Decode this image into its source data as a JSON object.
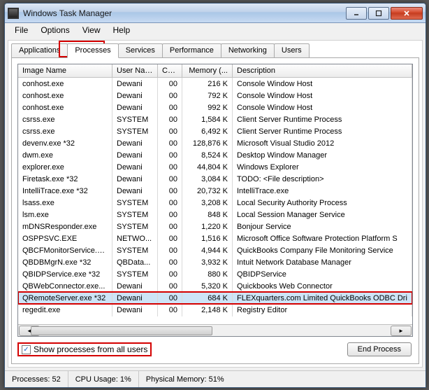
{
  "window": {
    "title": "Windows Task Manager"
  },
  "menu": {
    "file": "File",
    "options": "Options",
    "view": "View",
    "help": "Help"
  },
  "win_btns": {
    "min": "_",
    "max": "□",
    "close": "×"
  },
  "tabs": {
    "items": [
      {
        "label": "Applications"
      },
      {
        "label": "Processes"
      },
      {
        "label": "Services"
      },
      {
        "label": "Performance"
      },
      {
        "label": "Networking"
      },
      {
        "label": "Users"
      }
    ]
  },
  "columns": {
    "name": "Image Name",
    "user": "User Name",
    "cpu": "CPU",
    "mem": "Memory (...",
    "desc": "Description"
  },
  "rows": [
    {
      "name": "conhost.exe",
      "user": "Dewani",
      "cpu": "00",
      "mem": "216 K",
      "desc": "Console Window Host"
    },
    {
      "name": "conhost.exe",
      "user": "Dewani",
      "cpu": "00",
      "mem": "792 K",
      "desc": "Console Window Host"
    },
    {
      "name": "conhost.exe",
      "user": "Dewani",
      "cpu": "00",
      "mem": "992 K",
      "desc": "Console Window Host"
    },
    {
      "name": "csrss.exe",
      "user": "SYSTEM",
      "cpu": "00",
      "mem": "1,584 K",
      "desc": "Client Server Runtime Process"
    },
    {
      "name": "csrss.exe",
      "user": "SYSTEM",
      "cpu": "00",
      "mem": "6,492 K",
      "desc": "Client Server Runtime Process"
    },
    {
      "name": "devenv.exe *32",
      "user": "Dewani",
      "cpu": "00",
      "mem": "128,876 K",
      "desc": "Microsoft Visual Studio 2012"
    },
    {
      "name": "dwm.exe",
      "user": "Dewani",
      "cpu": "00",
      "mem": "8,524 K",
      "desc": "Desktop Window Manager"
    },
    {
      "name": "explorer.exe",
      "user": "Dewani",
      "cpu": "00",
      "mem": "44,804 K",
      "desc": "Windows Explorer"
    },
    {
      "name": "Firetask.exe *32",
      "user": "Dewani",
      "cpu": "00",
      "mem": "3,084 K",
      "desc": "TODO: <File description>"
    },
    {
      "name": "IntelliTrace.exe *32",
      "user": "Dewani",
      "cpu": "00",
      "mem": "20,732 K",
      "desc": "IntelliTrace.exe"
    },
    {
      "name": "lsass.exe",
      "user": "SYSTEM",
      "cpu": "00",
      "mem": "3,208 K",
      "desc": "Local Security Authority Process"
    },
    {
      "name": "lsm.exe",
      "user": "SYSTEM",
      "cpu": "00",
      "mem": "848 K",
      "desc": "Local Session Manager Service"
    },
    {
      "name": "mDNSResponder.exe",
      "user": "SYSTEM",
      "cpu": "00",
      "mem": "1,220 K",
      "desc": "Bonjour Service"
    },
    {
      "name": "OSPPSVC.EXE",
      "user": "NETWO...",
      "cpu": "00",
      "mem": "1,516 K",
      "desc": "Microsoft Office Software Protection Platform S"
    },
    {
      "name": "QBCFMonitorService.e...",
      "user": "SYSTEM",
      "cpu": "00",
      "mem": "4,944 K",
      "desc": "QuickBooks Company File Monitoring Service"
    },
    {
      "name": "QBDBMgrN.exe *32",
      "user": "QBData...",
      "cpu": "00",
      "mem": "3,932 K",
      "desc": "Intuit Network Database Manager"
    },
    {
      "name": "QBIDPService.exe *32",
      "user": "SYSTEM",
      "cpu": "00",
      "mem": "880 K",
      "desc": "QBIDPService"
    },
    {
      "name": "QBWebConnector.exe...",
      "user": "Dewani",
      "cpu": "00",
      "mem": "5,320 K",
      "desc": "Quickbooks Web Connector"
    },
    {
      "name": "QRemoteServer.exe *32",
      "user": "Dewani",
      "cpu": "00",
      "mem": "684 K",
      "desc": "FLEXquarters.com Limited QuickBooks ODBC Dri",
      "selected": true,
      "highlight": true
    },
    {
      "name": "regedit.exe",
      "user": "Dewani",
      "cpu": "00",
      "mem": "2,148 K",
      "desc": "Registry Editor"
    }
  ],
  "footer": {
    "show_all_label": "Show processes from all users",
    "end_process": "End Process"
  },
  "status": {
    "processes": "Processes: 52",
    "cpu": "CPU Usage: 1%",
    "mem": "Physical Memory: 51%"
  }
}
